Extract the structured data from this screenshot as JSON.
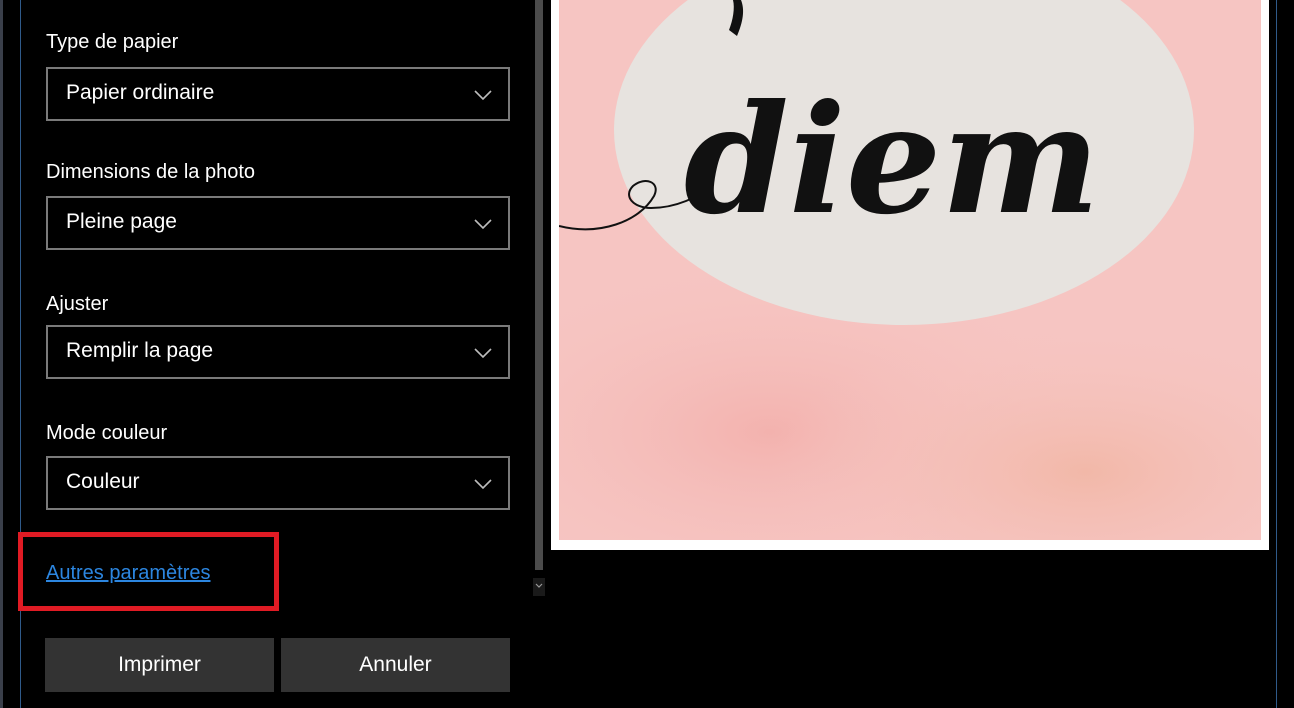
{
  "print_settings": {
    "paper_type": {
      "label": "Type de papier",
      "value": "Papier ordinaire"
    },
    "photo_size": {
      "label": "Dimensions de la photo",
      "value": "Pleine page"
    },
    "fit": {
      "label": "Ajuster",
      "value": "Remplir la page"
    },
    "color_mode": {
      "label": "Mode couleur",
      "value": "Couleur"
    },
    "more_settings_link": "Autres paramètres"
  },
  "buttons": {
    "print": "Imprimer",
    "cancel": "Annuler"
  },
  "preview": {
    "text": "diem",
    "background_color": "#f6c5c2",
    "circle_color": "#e7e3df",
    "text_color": "#111111"
  },
  "colors": {
    "highlight": "#e01b24",
    "link": "#2c86e0",
    "button_bg": "#333333"
  },
  "icons": {
    "dropdown": "chevron-down-icon",
    "scroll_down": "scroll-down-arrow-icon"
  }
}
